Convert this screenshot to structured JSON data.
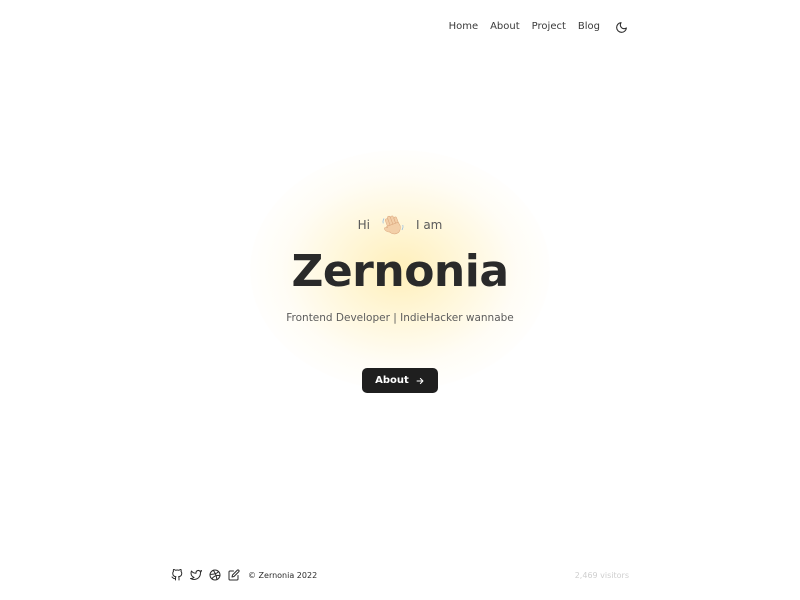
{
  "nav": {
    "items": [
      {
        "label": "Home",
        "active": true
      },
      {
        "label": "About",
        "active": false
      },
      {
        "label": "Project",
        "active": false
      },
      {
        "label": "Blog",
        "active": false
      }
    ],
    "theme_toggle_icon": "moon-icon"
  },
  "hero": {
    "greeting_before": "Hi",
    "greeting_icon": "waving-hand-icon",
    "greeting_after": "I am",
    "name": "Zernonia",
    "tagline": "Frontend Developer | IndieHacker wannabe",
    "cta_label": "About",
    "cta_icon": "arrow-right-icon"
  },
  "footer": {
    "icons": [
      "github-icon",
      "twitter-icon",
      "dribbble-icon",
      "edit-icon"
    ],
    "copyright": "© Zernonia 2022",
    "visitors": "2,469 visitors"
  },
  "colors": {
    "accent_glow": "#ffe082",
    "button_bg": "#1f1f1f",
    "text": "#2b2b2b"
  }
}
